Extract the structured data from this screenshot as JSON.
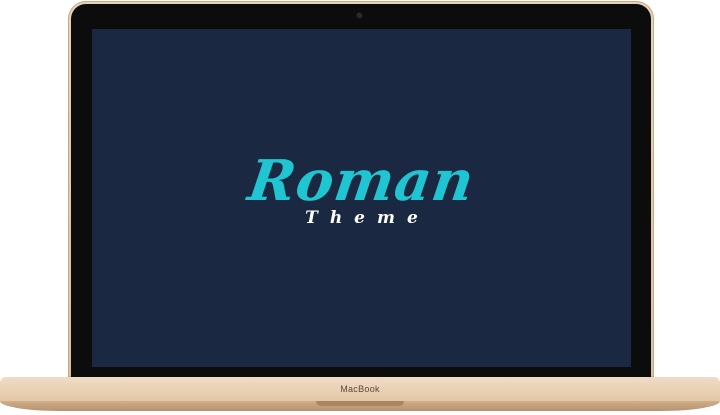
{
  "screen": {
    "title": "Roman",
    "subtitle": "Theme",
    "background": "#1b2842",
    "title_color": "#1fc6d2",
    "subtitle_color": "#ffffff"
  },
  "device": {
    "brand_label": "MacBook",
    "finish_color": "#e3c7a6"
  }
}
